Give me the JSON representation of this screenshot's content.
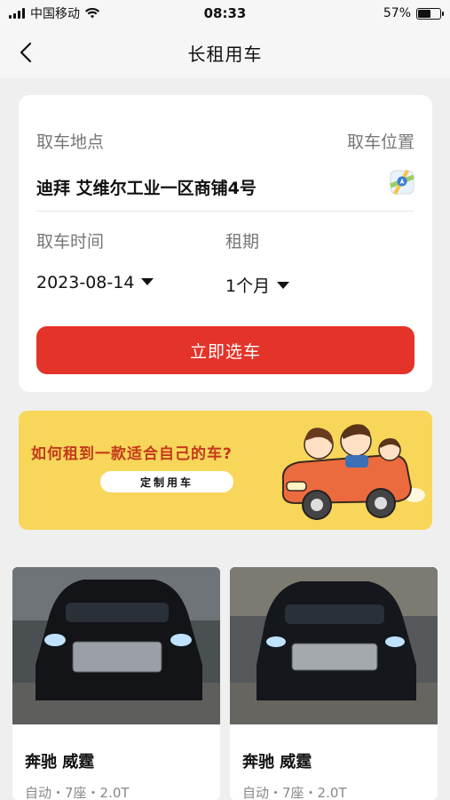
{
  "status_bar": {
    "carrier": "中国移动",
    "time": "08:33",
    "battery_percent": "57%",
    "battery_level": 0.57
  },
  "nav": {
    "title": "长租用车",
    "back_icon": "chevron-left-icon"
  },
  "pickup": {
    "location_label": "取车地点",
    "location_link": "取车位置",
    "address": "迪拜 艾维尔工业一区商铺4号",
    "map_icon": "map-pin-icon",
    "time_label": "取车时间",
    "time_value": "2023-08-14",
    "term_label": "租期",
    "term_value": "1个月",
    "submit_label": "立即选车"
  },
  "banner": {
    "headline": "如何租到一款适合自己的车?",
    "button_label": "定制用车"
  },
  "cars": [
    {
      "name": "奔驰 威霆",
      "spec": "自动・7座・2.0T"
    },
    {
      "name": "奔驰 威霆",
      "spec": "自动・7座・2.0T"
    }
  ],
  "colors": {
    "accent": "#e4342a",
    "banner_bg": "#f7d65a",
    "page_bg": "#efefef"
  }
}
